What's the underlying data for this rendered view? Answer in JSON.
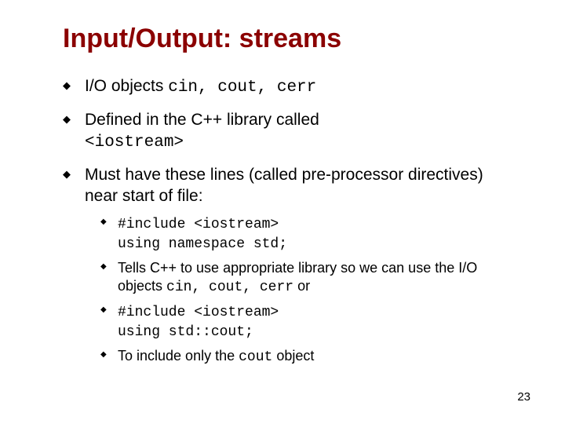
{
  "title": "Input/Output: streams",
  "bullets": {
    "b1_a": "I/O objects ",
    "b1_code": "cin, cout, cerr",
    "b2_a": "Defined in the C++ library called ",
    "b2_code": "<iostream>",
    "b3": "Must have these lines (called pre-processor directives) near start of file:"
  },
  "inner": {
    "i1_l1": "#include <iostream>",
    "i1_l2": "using namespace std;",
    "i2_a": "Tells C++ to use appropriate library so we can use the I/O objects ",
    "i2_code": "cin, cout, cerr",
    "i2_b": " or",
    "i3_l1": "#include <iostream>",
    "i3_l2": "using std::cout;",
    "i4_a": "To include only the ",
    "i4_code": "cout",
    "i4_b": "  object"
  },
  "page": "23"
}
